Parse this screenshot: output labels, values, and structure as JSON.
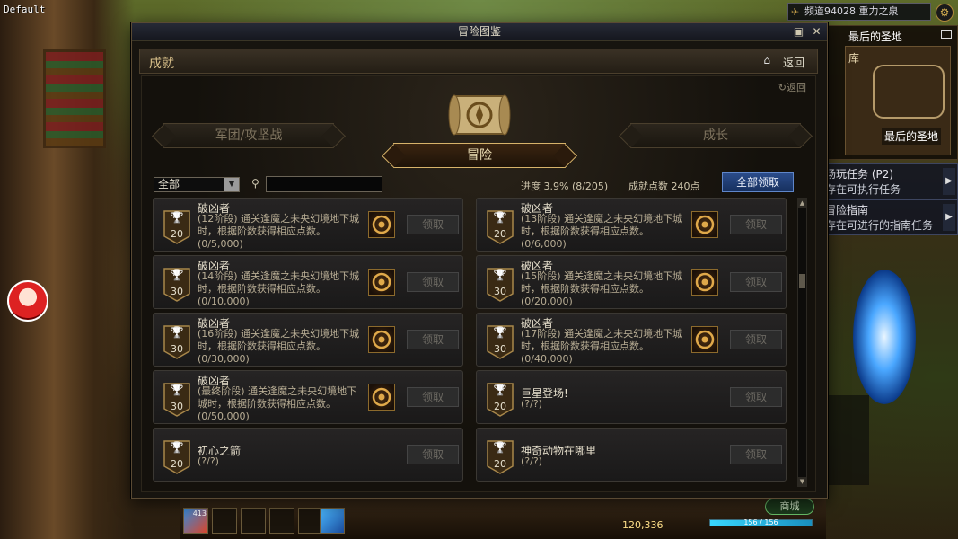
{
  "overlay": {
    "default_label": "Default"
  },
  "hud": {
    "channel": "频道94028 重力之泉",
    "minimap_title": "最后的圣地",
    "minimap_corner": "库",
    "minimap_location": "最后的圣地",
    "quests": [
      {
        "title": "场玩任务 (P2)",
        "sub": "存在可执行任务"
      },
      {
        "title": "冒险指南",
        "sub": "存在可进行的指南任务"
      }
    ],
    "gold": "120,336",
    "hp_fraction": 1.0,
    "hp_text": "156 / 156",
    "shop_label": "商城",
    "skill_count": "413"
  },
  "window": {
    "title": "冒险图鉴",
    "section_title": "成就",
    "back_label": "返回",
    "sub_back_label": "返回",
    "tabs": [
      {
        "label": "军团/攻坚战",
        "active": false
      },
      {
        "label": "冒险",
        "active": true
      },
      {
        "label": "成长",
        "active": false
      }
    ],
    "filter_value": "全部",
    "search_placeholder": "",
    "progress_label": "进度  3.9% (8/205)",
    "points_label": "成就点数 240点",
    "claim_all_label": "全部领取",
    "cards": [
      {
        "title": "破凶者",
        "desc": "(12阶段) 通关逢魔之未央幻境地下城时，根据阶数获得相应点数。",
        "progress": "(0/5,000)",
        "points": "20",
        "has_reward": true,
        "claim": "领取"
      },
      {
        "title": "破凶者",
        "desc": "(13阶段) 通关逢魔之未央幻境地下城时，根据阶数获得相应点数。",
        "progress": "(0/6,000)",
        "points": "20",
        "has_reward": true,
        "claim": "领取"
      },
      {
        "title": "破凶者",
        "desc": "(14阶段) 通关逢魔之未央幻境地下城时，根据阶数获得相应点数。",
        "progress": "(0/10,000)",
        "points": "30",
        "has_reward": true,
        "claim": "领取"
      },
      {
        "title": "破凶者",
        "desc": "(15阶段) 通关逢魔之未央幻境地下城时，根据阶数获得相应点数。",
        "progress": "(0/20,000)",
        "points": "30",
        "has_reward": true,
        "claim": "领取"
      },
      {
        "title": "破凶者",
        "desc": "(16阶段) 通关逢魔之未央幻境地下城时，根据阶数获得相应点数。",
        "progress": "(0/30,000)",
        "points": "30",
        "has_reward": true,
        "claim": "领取"
      },
      {
        "title": "破凶者",
        "desc": "(17阶段) 通关逢魔之未央幻境地下城时，根据阶数获得相应点数。",
        "progress": "(0/40,000)",
        "points": "30",
        "has_reward": true,
        "claim": "领取"
      },
      {
        "title": "破凶者",
        "desc": "(最终阶段) 通关逢魔之未央幻境地下城时，根据阶数获得相应点数。",
        "progress": "(0/50,000)",
        "points": "30",
        "has_reward": true,
        "claim": "领取"
      },
      {
        "title": "巨星登场!",
        "desc": "(?/?)",
        "progress": "",
        "points": "20",
        "has_reward": false,
        "claim": "领取"
      },
      {
        "title": "初心之箭",
        "desc": "(?/?)",
        "progress": "",
        "points": "20",
        "has_reward": false,
        "claim": "领取"
      },
      {
        "title": "神奇动物在哪里",
        "desc": "(?/?)",
        "progress": "",
        "points": "20",
        "has_reward": false,
        "claim": "领取"
      }
    ]
  },
  "icons": {
    "home": "home-icon",
    "search": "search-icon",
    "trophy": "trophy-icon",
    "reward": "reward-emblem-icon",
    "scroll": "compass-scroll-icon"
  },
  "colors": {
    "accent_gold": "#d7b36a",
    "claim_all_blue": "#2b4c8a"
  }
}
